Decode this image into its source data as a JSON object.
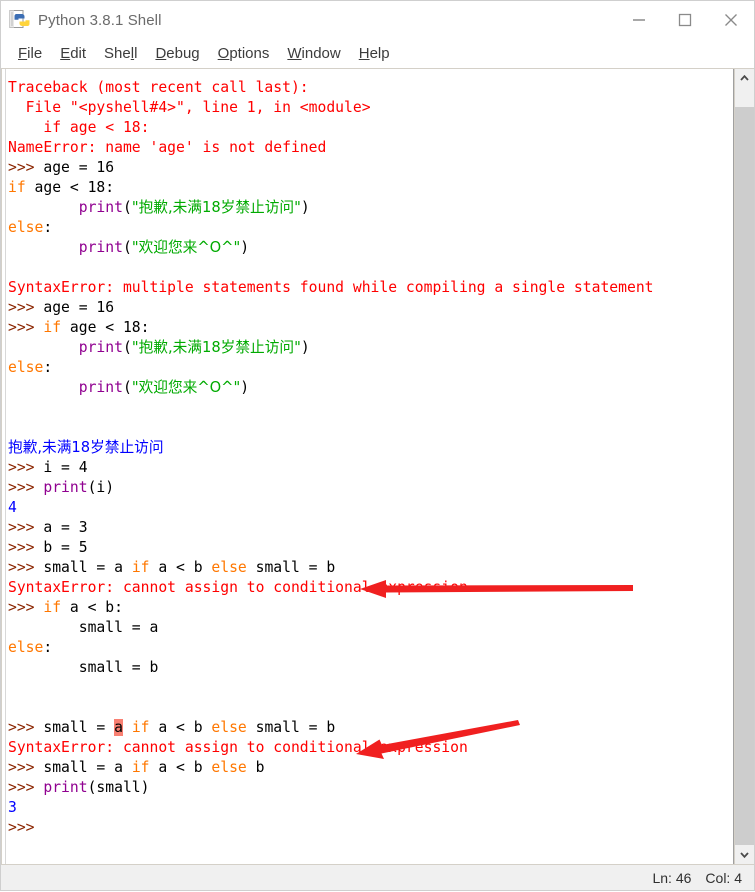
{
  "window": {
    "title": "Python 3.8.1 Shell",
    "icon": "python-idle-icon",
    "controls": [
      {
        "name": "minimize-button",
        "glyph": "minimize-icon"
      },
      {
        "name": "maximize-button",
        "glyph": "maximize-icon"
      },
      {
        "name": "close-button",
        "glyph": "close-icon"
      }
    ]
  },
  "menubar": {
    "items": [
      {
        "label": "File",
        "accel": "F"
      },
      {
        "label": "Edit",
        "accel": "E"
      },
      {
        "label": "Shell",
        "accel": "l"
      },
      {
        "label": "Debug",
        "accel": "D"
      },
      {
        "label": "Options",
        "accel": "O"
      },
      {
        "label": "Window",
        "accel": "W"
      },
      {
        "label": "Help",
        "accel": "H"
      }
    ]
  },
  "colors": {
    "prompt": "#8b2500",
    "keyword": "#ff7700",
    "builtin": "#900090",
    "string": "#00aa00",
    "stderr": "#ff0000",
    "stdout": "#0000ff",
    "definition": "#000000",
    "hit_highlight": "#f98072",
    "annotation_arrow": "#f02020"
  },
  "console": {
    "lines": [
      {
        "spans": [
          {
            "t": "Traceback (most recent call last):",
            "c": "err"
          }
        ]
      },
      {
        "spans": [
          {
            "t": "  File \"<pyshell#4>\", line 1, in <module>",
            "c": "err"
          }
        ]
      },
      {
        "spans": [
          {
            "t": "    if age < 18:",
            "c": "err"
          }
        ]
      },
      {
        "spans": [
          {
            "t": "NameError: name 'age' is not defined",
            "c": "err"
          }
        ]
      },
      {
        "spans": [
          {
            "t": ">>> ",
            "c": "prompt"
          },
          {
            "t": "age = 16",
            "c": "def"
          }
        ]
      },
      {
        "spans": [
          {
            "t": "if",
            "c": "kw"
          },
          {
            "t": " age < 18:",
            "c": "def"
          }
        ]
      },
      {
        "spans": [
          {
            "t": "        ",
            "c": "def"
          },
          {
            "t": "print",
            "c": "builtin"
          },
          {
            "t": "(",
            "c": "def"
          },
          {
            "t": "\"抱歉,未满18岁禁止访问\"",
            "c": "str"
          },
          {
            "t": ")",
            "c": "def"
          }
        ]
      },
      {
        "spans": [
          {
            "t": "else",
            "c": "kw"
          },
          {
            "t": ":",
            "c": "def"
          }
        ]
      },
      {
        "spans": [
          {
            "t": "        ",
            "c": "def"
          },
          {
            "t": "print",
            "c": "builtin"
          },
          {
            "t": "(",
            "c": "def"
          },
          {
            "t": "\"欢迎您来^O^\"",
            "c": "str"
          },
          {
            "t": ")",
            "c": "def"
          }
        ]
      },
      {
        "spans": [
          {
            "t": "",
            "c": "def"
          }
        ]
      },
      {
        "spans": [
          {
            "t": "SyntaxError: multiple statements found while compiling a single statement",
            "c": "err"
          }
        ]
      },
      {
        "spans": [
          {
            "t": ">>> ",
            "c": "prompt"
          },
          {
            "t": "age = 16",
            "c": "def"
          }
        ]
      },
      {
        "spans": [
          {
            "t": ">>> ",
            "c": "prompt"
          },
          {
            "t": "if",
            "c": "kw"
          },
          {
            "t": " age < 18:",
            "c": "def"
          }
        ]
      },
      {
        "spans": [
          {
            "t": "        ",
            "c": "def"
          },
          {
            "t": "print",
            "c": "builtin"
          },
          {
            "t": "(",
            "c": "def"
          },
          {
            "t": "\"抱歉,未满18岁禁止访问\"",
            "c": "str"
          },
          {
            "t": ")",
            "c": "def"
          }
        ]
      },
      {
        "spans": [
          {
            "t": "else",
            "c": "kw"
          },
          {
            "t": ":",
            "c": "def"
          }
        ]
      },
      {
        "spans": [
          {
            "t": "        ",
            "c": "def"
          },
          {
            "t": "print",
            "c": "builtin"
          },
          {
            "t": "(",
            "c": "def"
          },
          {
            "t": "\"欢迎您来^O^\"",
            "c": "str"
          },
          {
            "t": ")",
            "c": "def"
          }
        ]
      },
      {
        "spans": [
          {
            "t": "",
            "c": "def"
          }
        ]
      },
      {
        "spans": [
          {
            "t": "",
            "c": "def"
          }
        ]
      },
      {
        "spans": [
          {
            "t": "抱歉,未满18岁禁止访问",
            "c": "out"
          }
        ]
      },
      {
        "spans": [
          {
            "t": ">>> ",
            "c": "prompt"
          },
          {
            "t": "i = 4",
            "c": "def"
          }
        ]
      },
      {
        "spans": [
          {
            "t": ">>> ",
            "c": "prompt"
          },
          {
            "t": "print",
            "c": "builtin"
          },
          {
            "t": "(i)",
            "c": "def"
          }
        ]
      },
      {
        "spans": [
          {
            "t": "4",
            "c": "out"
          }
        ]
      },
      {
        "spans": [
          {
            "t": ">>> ",
            "c": "prompt"
          },
          {
            "t": "a = 3",
            "c": "def"
          }
        ]
      },
      {
        "spans": [
          {
            "t": ">>> ",
            "c": "prompt"
          },
          {
            "t": "b = 5",
            "c": "def"
          }
        ]
      },
      {
        "spans": [
          {
            "t": ">>> ",
            "c": "prompt"
          },
          {
            "t": "small = a ",
            "c": "def"
          },
          {
            "t": "if",
            "c": "kw"
          },
          {
            "t": " a < b ",
            "c": "def"
          },
          {
            "t": "else",
            "c": "kw"
          },
          {
            "t": " small = b",
            "c": "def"
          }
        ]
      },
      {
        "spans": [
          {
            "t": "SyntaxError: cannot assign to conditional expression",
            "c": "err"
          }
        ]
      },
      {
        "spans": [
          {
            "t": ">>> ",
            "c": "prompt"
          },
          {
            "t": "if",
            "c": "kw"
          },
          {
            "t": " a < b:",
            "c": "def"
          }
        ]
      },
      {
        "spans": [
          {
            "t": "        small = a",
            "c": "def"
          }
        ]
      },
      {
        "spans": [
          {
            "t": "else",
            "c": "kw"
          },
          {
            "t": ":",
            "c": "def"
          }
        ]
      },
      {
        "spans": [
          {
            "t": "        small = b",
            "c": "def"
          }
        ]
      },
      {
        "spans": [
          {
            "t": "",
            "c": "def"
          }
        ]
      },
      {
        "spans": [
          {
            "t": "",
            "c": "def"
          }
        ]
      },
      {
        "spans": [
          {
            "t": ">>> ",
            "c": "prompt"
          },
          {
            "t": "small = ",
            "c": "def"
          },
          {
            "t": "a",
            "c": "hit"
          },
          {
            "t": " ",
            "c": "def"
          },
          {
            "t": "if",
            "c": "kw"
          },
          {
            "t": " a < b ",
            "c": "def"
          },
          {
            "t": "else",
            "c": "kw"
          },
          {
            "t": " small = b",
            "c": "def"
          }
        ]
      },
      {
        "spans": [
          {
            "t": "SyntaxError: cannot assign to conditional expression",
            "c": "err"
          }
        ]
      },
      {
        "spans": [
          {
            "t": ">>> ",
            "c": "prompt"
          },
          {
            "t": "small = a ",
            "c": "def"
          },
          {
            "t": "if",
            "c": "kw"
          },
          {
            "t": " a < b ",
            "c": "def"
          },
          {
            "t": "else",
            "c": "kw"
          },
          {
            "t": " b",
            "c": "def"
          }
        ]
      },
      {
        "spans": [
          {
            "t": ">>> ",
            "c": "prompt"
          },
          {
            "t": "print",
            "c": "builtin"
          },
          {
            "t": "(small)",
            "c": "def"
          }
        ]
      },
      {
        "spans": [
          {
            "t": "3",
            "c": "out"
          }
        ]
      },
      {
        "spans": [
          {
            "t": ">>>",
            "c": "prompt"
          }
        ]
      }
    ]
  },
  "annotations": [
    {
      "name": "arrow-annotation-first",
      "shape": "left-arrow-horizontal"
    },
    {
      "name": "arrow-annotation-second",
      "shape": "left-arrow-diagonal"
    }
  ],
  "statusbar": {
    "line_label": "Ln: 46",
    "col_label": "Col: 4"
  },
  "scrollbar": {
    "up_arrow": "chevron-up-icon",
    "down_arrow": "chevron-down-icon"
  }
}
